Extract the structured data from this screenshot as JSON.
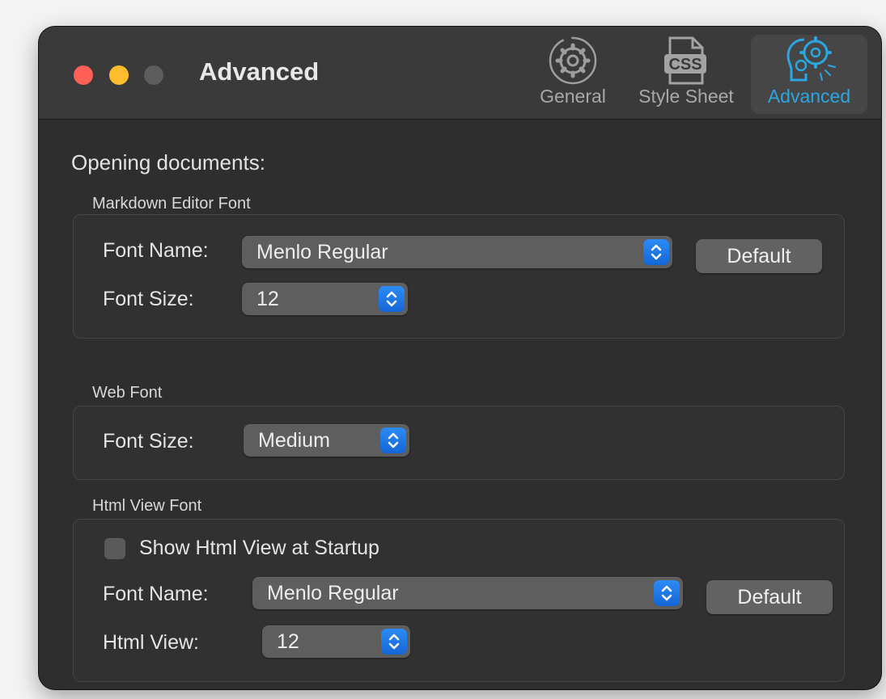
{
  "window": {
    "title": "Advanced"
  },
  "toolbar": {
    "items": [
      {
        "label": "General",
        "icon": "gear-icon"
      },
      {
        "label": "Style Sheet",
        "icon": "css-file-icon"
      },
      {
        "label": "Advanced",
        "icon": "brain-gear-icon",
        "selected": true
      }
    ],
    "accent_color": "#2aa6e3"
  },
  "content": {
    "heading": "Opening documents:",
    "markdown_editor": {
      "group_label": "Markdown Editor Font",
      "font_name_label": "Font Name:",
      "font_name_value": "Menlo Regular",
      "default_button": "Default",
      "font_size_label": "Font Size:",
      "font_size_value": "12"
    },
    "web_font": {
      "group_label": "Web Font",
      "font_size_label": "Font Size:",
      "font_size_value": "Medium"
    },
    "html_view": {
      "group_label": "Html View Font",
      "checkbox_label": "Show Html View at Startup",
      "checkbox_checked": false,
      "font_name_label": "Font Name:",
      "font_name_value": "Menlo Regular",
      "default_button": "Default",
      "size_label": "Html View:",
      "size_value": "12"
    }
  }
}
